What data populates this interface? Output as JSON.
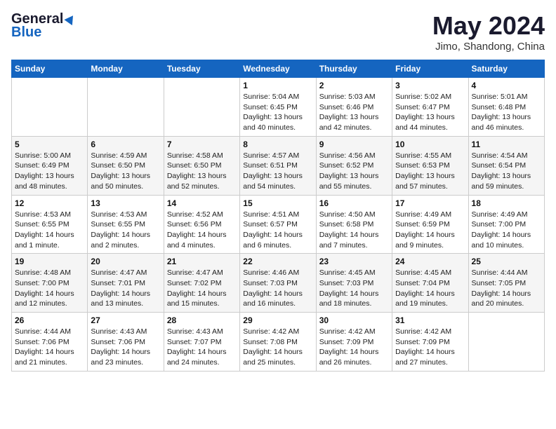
{
  "header": {
    "logo_general": "General",
    "logo_blue": "Blue",
    "month_year": "May 2024",
    "location": "Jimo, Shandong, China"
  },
  "weekdays": [
    "Sunday",
    "Monday",
    "Tuesday",
    "Wednesday",
    "Thursday",
    "Friday",
    "Saturday"
  ],
  "weeks": [
    [
      {
        "day": "",
        "info": ""
      },
      {
        "day": "",
        "info": ""
      },
      {
        "day": "",
        "info": ""
      },
      {
        "day": "1",
        "info": "Sunrise: 5:04 AM\nSunset: 6:45 PM\nDaylight: 13 hours\nand 40 minutes."
      },
      {
        "day": "2",
        "info": "Sunrise: 5:03 AM\nSunset: 6:46 PM\nDaylight: 13 hours\nand 42 minutes."
      },
      {
        "day": "3",
        "info": "Sunrise: 5:02 AM\nSunset: 6:47 PM\nDaylight: 13 hours\nand 44 minutes."
      },
      {
        "day": "4",
        "info": "Sunrise: 5:01 AM\nSunset: 6:48 PM\nDaylight: 13 hours\nand 46 minutes."
      }
    ],
    [
      {
        "day": "5",
        "info": "Sunrise: 5:00 AM\nSunset: 6:49 PM\nDaylight: 13 hours\nand 48 minutes."
      },
      {
        "day": "6",
        "info": "Sunrise: 4:59 AM\nSunset: 6:50 PM\nDaylight: 13 hours\nand 50 minutes."
      },
      {
        "day": "7",
        "info": "Sunrise: 4:58 AM\nSunset: 6:50 PM\nDaylight: 13 hours\nand 52 minutes."
      },
      {
        "day": "8",
        "info": "Sunrise: 4:57 AM\nSunset: 6:51 PM\nDaylight: 13 hours\nand 54 minutes."
      },
      {
        "day": "9",
        "info": "Sunrise: 4:56 AM\nSunset: 6:52 PM\nDaylight: 13 hours\nand 55 minutes."
      },
      {
        "day": "10",
        "info": "Sunrise: 4:55 AM\nSunset: 6:53 PM\nDaylight: 13 hours\nand 57 minutes."
      },
      {
        "day": "11",
        "info": "Sunrise: 4:54 AM\nSunset: 6:54 PM\nDaylight: 13 hours\nand 59 minutes."
      }
    ],
    [
      {
        "day": "12",
        "info": "Sunrise: 4:53 AM\nSunset: 6:55 PM\nDaylight: 14 hours\nand 1 minute."
      },
      {
        "day": "13",
        "info": "Sunrise: 4:53 AM\nSunset: 6:55 PM\nDaylight: 14 hours\nand 2 minutes."
      },
      {
        "day": "14",
        "info": "Sunrise: 4:52 AM\nSunset: 6:56 PM\nDaylight: 14 hours\nand 4 minutes."
      },
      {
        "day": "15",
        "info": "Sunrise: 4:51 AM\nSunset: 6:57 PM\nDaylight: 14 hours\nand 6 minutes."
      },
      {
        "day": "16",
        "info": "Sunrise: 4:50 AM\nSunset: 6:58 PM\nDaylight: 14 hours\nand 7 minutes."
      },
      {
        "day": "17",
        "info": "Sunrise: 4:49 AM\nSunset: 6:59 PM\nDaylight: 14 hours\nand 9 minutes."
      },
      {
        "day": "18",
        "info": "Sunrise: 4:49 AM\nSunset: 7:00 PM\nDaylight: 14 hours\nand 10 minutes."
      }
    ],
    [
      {
        "day": "19",
        "info": "Sunrise: 4:48 AM\nSunset: 7:00 PM\nDaylight: 14 hours\nand 12 minutes."
      },
      {
        "day": "20",
        "info": "Sunrise: 4:47 AM\nSunset: 7:01 PM\nDaylight: 14 hours\nand 13 minutes."
      },
      {
        "day": "21",
        "info": "Sunrise: 4:47 AM\nSunset: 7:02 PM\nDaylight: 14 hours\nand 15 minutes."
      },
      {
        "day": "22",
        "info": "Sunrise: 4:46 AM\nSunset: 7:03 PM\nDaylight: 14 hours\nand 16 minutes."
      },
      {
        "day": "23",
        "info": "Sunrise: 4:45 AM\nSunset: 7:03 PM\nDaylight: 14 hours\nand 18 minutes."
      },
      {
        "day": "24",
        "info": "Sunrise: 4:45 AM\nSunset: 7:04 PM\nDaylight: 14 hours\nand 19 minutes."
      },
      {
        "day": "25",
        "info": "Sunrise: 4:44 AM\nSunset: 7:05 PM\nDaylight: 14 hours\nand 20 minutes."
      }
    ],
    [
      {
        "day": "26",
        "info": "Sunrise: 4:44 AM\nSunset: 7:06 PM\nDaylight: 14 hours\nand 21 minutes."
      },
      {
        "day": "27",
        "info": "Sunrise: 4:43 AM\nSunset: 7:06 PM\nDaylight: 14 hours\nand 23 minutes."
      },
      {
        "day": "28",
        "info": "Sunrise: 4:43 AM\nSunset: 7:07 PM\nDaylight: 14 hours\nand 24 minutes."
      },
      {
        "day": "29",
        "info": "Sunrise: 4:42 AM\nSunset: 7:08 PM\nDaylight: 14 hours\nand 25 minutes."
      },
      {
        "day": "30",
        "info": "Sunrise: 4:42 AM\nSunset: 7:09 PM\nDaylight: 14 hours\nand 26 minutes."
      },
      {
        "day": "31",
        "info": "Sunrise: 4:42 AM\nSunset: 7:09 PM\nDaylight: 14 hours\nand 27 minutes."
      },
      {
        "day": "",
        "info": ""
      }
    ]
  ]
}
